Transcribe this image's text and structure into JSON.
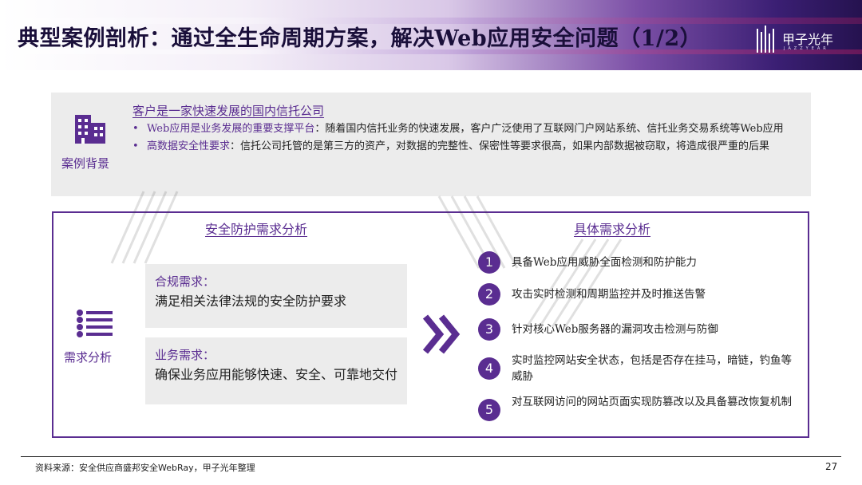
{
  "header": {
    "title": "典型案例剖析：通过全生命周期方案，解决Web应用安全问题（1/2）",
    "logo_text": "甲子光年",
    "logo_sub": "JAZZYEAR"
  },
  "background_section": {
    "label": "案例背景",
    "icon": "building-icon",
    "heading": "客户是一家快速发展的国内信托公司",
    "bullets": [
      {
        "marker": "•",
        "highlight": "Web应用是业务发展的重要支撑平台",
        "text": "：随着国内信托业务的快速发展，客户广泛使用了互联网门户网站系统、信托业务交易系统等Web应用"
      },
      {
        "marker": "•",
        "highlight": "高数据安全性要求",
        "text": "：信托公司托管的是第三方的资产，对数据的完整性、保密性等要求很高，如果内部数据被窃取，将造成很严重的后果"
      }
    ]
  },
  "requirements": {
    "label": "需求分析",
    "icon": "list-icon",
    "left_title": "安全防护需求分析",
    "right_title": "具体需求分析",
    "cards": [
      {
        "title": "合规需求：",
        "body": "满足相关法律法规的安全防护要求"
      },
      {
        "title": "业务需求：",
        "body": "确保业务应用能够快速、安全、可靠地交付"
      }
    ],
    "arrow_icon": "double-chevron-right-icon",
    "items": [
      {
        "num": "1",
        "text": "具备Web应用威胁全面检测和防护能力"
      },
      {
        "num": "2",
        "text": "攻击实时检测和周期监控并及时推送告警"
      },
      {
        "num": "3",
        "text": "针对核心Web服务器的漏洞攻击检测与防御"
      },
      {
        "num": "4",
        "text": "实时监控网站安全状态，包括是否存在挂马，暗链，钓鱼等威胁"
      },
      {
        "num": "5",
        "text": "对互联网访问的网站页面实现防篡改以及具备篡改恢复机制"
      }
    ]
  },
  "footer": {
    "source": "资料来源：安全供应商盛邦安全WebRay，甲子光年整理",
    "page": "27"
  },
  "colors": {
    "accent": "#5a2d91",
    "card_bg": "#ececec",
    "header_dark": "#25124f"
  }
}
